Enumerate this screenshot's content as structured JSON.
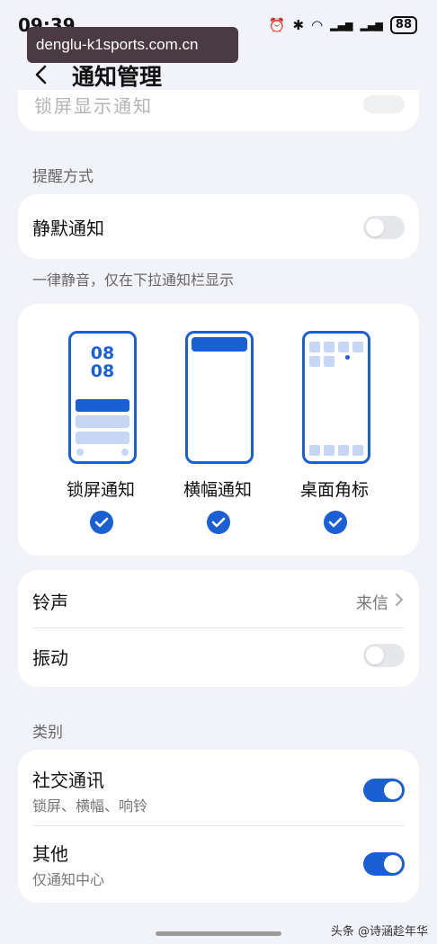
{
  "status_bar": {
    "time": "09:39",
    "battery": "88",
    "alarm_glyph": "⏰",
    "bluetooth_glyph": "✱",
    "wifi_glyph": "◠",
    "signal_glyph": "▂▄▆",
    "signal2_glyph": "▂▄▆"
  },
  "url_overlay": "denglu-k1sports.com.cn",
  "header": {
    "title": "通知管理"
  },
  "top_partial": {
    "text": "锁屏显示通知"
  },
  "reminder_section": {
    "label": "提醒方式",
    "silent": {
      "label": "静默通知",
      "enabled": false
    },
    "hint": "一律静音，仅在下拉通知栏显示"
  },
  "styles": [
    {
      "label": "锁屏通知",
      "checked": true,
      "clock_top": "08",
      "clock_bottom": "08"
    },
    {
      "label": "横幅通知",
      "checked": true
    },
    {
      "label": "桌面角标",
      "checked": true
    }
  ],
  "sound_card": {
    "ringtone": {
      "label": "铃声",
      "value": "来信"
    },
    "vibrate": {
      "label": "振动",
      "enabled": false
    }
  },
  "category_section": {
    "label": "类别",
    "items": [
      {
        "label": "社交通讯",
        "sub": "锁屏、横幅、响铃",
        "enabled": true
      },
      {
        "label": "其他",
        "sub": "仅通知中心",
        "enabled": true
      }
    ]
  },
  "watermark": "头条 @诗涵趁年华",
  "colors": {
    "accent": "#1a5fd4",
    "background": "#f1f3f8",
    "card": "#ffffff"
  }
}
